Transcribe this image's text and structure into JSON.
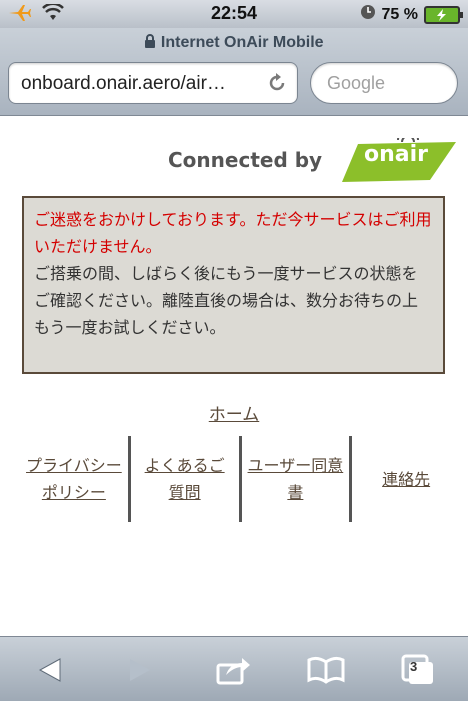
{
  "status_bar": {
    "time": "22:54",
    "battery": "75 %",
    "icons": [
      "airplane-icon",
      "wifi-icon",
      "clock-icon",
      "battery-charging-icon"
    ]
  },
  "browser": {
    "page_title": "Internet OnAir Mobile",
    "url": "onboard.onair.aero/air…",
    "search_placeholder": "Google",
    "tabs_count": "3"
  },
  "page": {
    "logo": {
      "connected_by": "Connected by",
      "brand": "onair"
    },
    "notice": {
      "error_text": "ご迷惑をおかけしております。ただ今サービスはご利用いただけません。",
      "info_text": "ご搭乗の間、しばらく後にもう一度サービスの状態をご確認ください。離陸直後の場合は、数分お待ちの上もう一度お試しください。"
    },
    "home_link": "ホーム",
    "footer_links": [
      {
        "label": "プライバシーポリシー"
      },
      {
        "label": "よくあるご質問"
      },
      {
        "label": "ユーザー同意書"
      },
      {
        "label": "連絡先"
      }
    ]
  },
  "colors": {
    "error_red": "#d40000",
    "brand_green": "#8cbf2a",
    "link_brown": "#5a4a3a"
  }
}
